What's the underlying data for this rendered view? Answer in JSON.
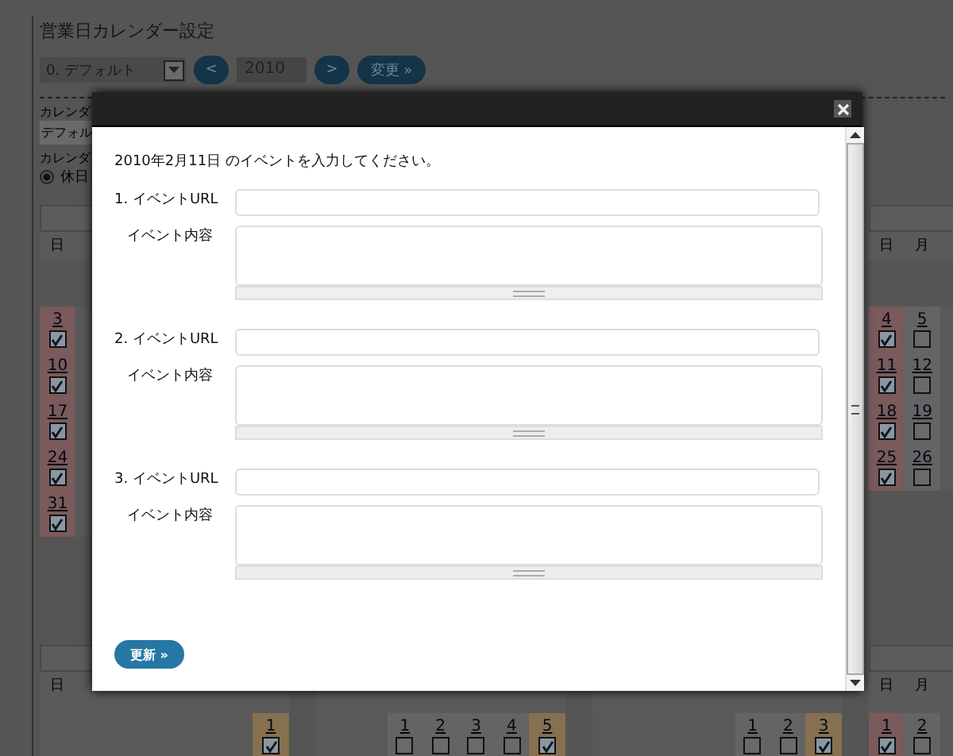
{
  "page": {
    "title": "営業日カレンダー設定",
    "calendar_select": "0. デフォルト",
    "prev_button": "<",
    "year": "2010",
    "next_button": ">",
    "change_button": "変更 »",
    "label_1": "カレンダ",
    "name_field": "デフォル",
    "label_2": "カレンダ",
    "radio": {
      "label": "休日",
      "selected": true
    }
  },
  "calendar_rows": [
    {
      "months": [
        {
          "weekdays": [
            "日"
          ],
          "weeks": [
            [
              {
                "day": "3",
                "checked": true,
                "kind": "sunday"
              }
            ],
            [
              {
                "day": "10",
                "checked": true,
                "kind": "sunday"
              }
            ],
            [
              {
                "day": "17",
                "checked": true,
                "kind": "sunday"
              }
            ],
            [
              {
                "day": "24",
                "checked": true,
                "kind": "sunday"
              }
            ],
            [
              {
                "day": "31",
                "checked": true,
                "kind": "sunday"
              }
            ]
          ]
        },
        {
          "weekdays": [
            "日",
            "月"
          ],
          "weeks": [
            [
              {
                "day": "4",
                "checked": true,
                "kind": "sunday"
              },
              {
                "day": "5",
                "checked": false,
                "kind": "monday"
              }
            ],
            [
              {
                "day": "11",
                "checked": true,
                "kind": "sunday"
              },
              {
                "day": "12",
                "checked": false,
                "kind": "monday"
              }
            ],
            [
              {
                "day": "18",
                "checked": true,
                "kind": "sunday"
              },
              {
                "day": "19",
                "checked": false,
                "kind": "monday"
              }
            ],
            [
              {
                "day": "25",
                "checked": true,
                "kind": "sunday"
              },
              {
                "day": "26",
                "checked": false,
                "kind": "monday"
              }
            ]
          ]
        }
      ]
    },
    {
      "months": [
        {
          "weekdays": [
            "日"
          ],
          "weeks": [
            [
              {
                "day": "1",
                "checked": true,
                "kind": "saturday"
              }
            ]
          ]
        },
        {
          "weeks": [
            [
              {
                "day": "1",
                "checked": false,
                "kind": "tuesday"
              },
              {
                "day": "2",
                "checked": false,
                "kind": "wednesday"
              },
              {
                "day": "3",
                "checked": false,
                "kind": "thursday"
              },
              {
                "day": "4",
                "checked": false,
                "kind": "friday"
              },
              {
                "day": "5",
                "checked": true,
                "kind": "saturday"
              }
            ]
          ]
        },
        {
          "weeks": [
            [
              {
                "day": "1",
                "checked": false,
                "kind": "thursday"
              },
              {
                "day": "2",
                "checked": false,
                "kind": "friday"
              },
              {
                "day": "3",
                "checked": true,
                "kind": "saturday"
              }
            ]
          ]
        },
        {
          "weekdays": [
            "日",
            "月"
          ],
          "weeks": [
            [
              {
                "day": "1",
                "checked": true,
                "kind": "sunday"
              },
              {
                "day": "2",
                "checked": false,
                "kind": "monday"
              }
            ]
          ]
        }
      ]
    }
  ],
  "dialog": {
    "intro": "2010年2月11日 のイベントを入力してください。",
    "events": [
      {
        "url_label": "1. イベントURL",
        "content_label": "イベント内容"
      },
      {
        "url_label": "2. イベントURL",
        "content_label": "イベント内容"
      },
      {
        "url_label": "3. イベントURL",
        "content_label": "イベント内容"
      }
    ],
    "submit_button": "更新 »"
  }
}
